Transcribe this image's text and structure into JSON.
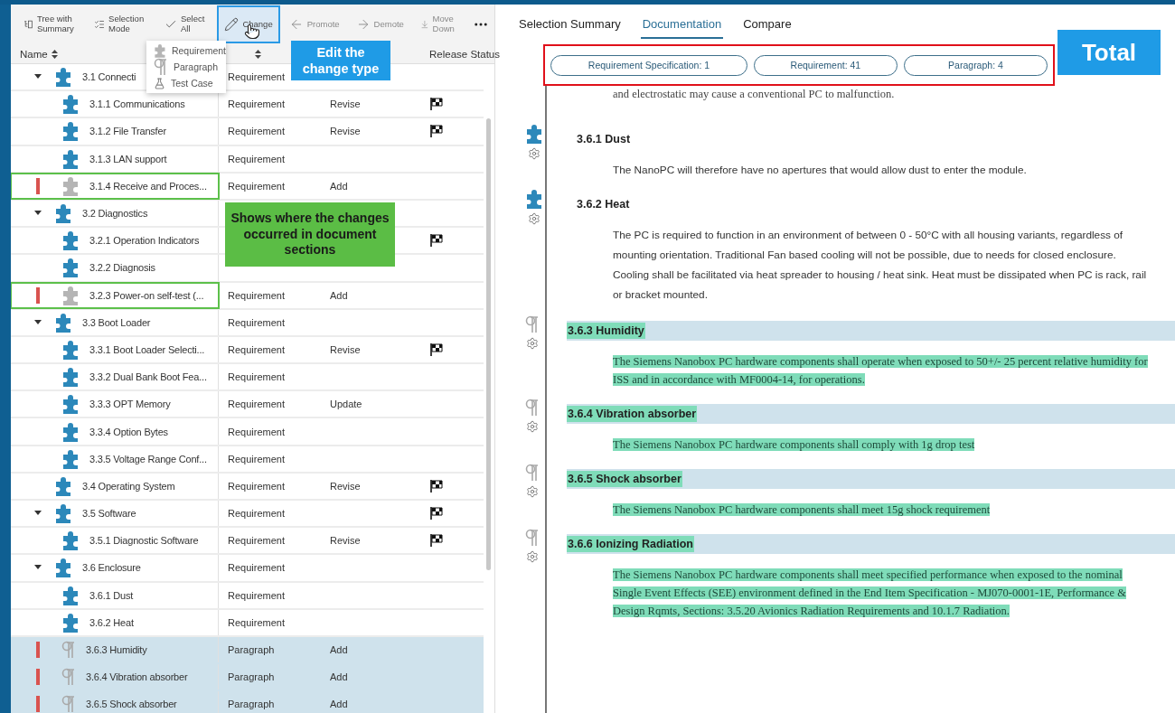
{
  "toolbar": {
    "items": [
      {
        "label": "Tree with Summary",
        "disabled": false,
        "outlined": false
      },
      {
        "label": "Selection Mode",
        "disabled": false,
        "outlined": false
      },
      {
        "label": "Select All",
        "disabled": false,
        "outlined": false
      },
      {
        "label": "Change",
        "disabled": false,
        "outlined": true
      },
      {
        "label": "Promote",
        "disabled": true,
        "outlined": false
      },
      {
        "label": "Demote",
        "disabled": true,
        "outlined": false
      },
      {
        "label": "Move Down",
        "disabled": true,
        "outlined": false
      }
    ]
  },
  "change_menu": {
    "items": [
      {
        "label": "Requirement"
      },
      {
        "label": "Paragraph"
      },
      {
        "label": "Test Case"
      }
    ]
  },
  "columns": {
    "name": "Name",
    "release_status": "Release Status"
  },
  "tree": [
    {
      "name": "3.1 Connecti",
      "type": "Requirement",
      "kind": "requirement",
      "expanded": true,
      "changed": false,
      "outlined": false,
      "selected": false,
      "flag": false,
      "children": [
        {
          "name": "3.1.1 Communications",
          "type": "Requirement",
          "change": "Revise",
          "kind": "requirement",
          "changed": false,
          "outlined": false,
          "selected": false,
          "flag": true
        },
        {
          "name": "3.1.2 File Transfer",
          "type": "Requirement",
          "change": "Revise",
          "kind": "requirement",
          "changed": false,
          "outlined": false,
          "selected": false,
          "flag": true
        },
        {
          "name": "3.1.3 LAN support",
          "type": "Requirement",
          "kind": "requirement",
          "changed": false,
          "outlined": false,
          "selected": false,
          "flag": false
        },
        {
          "name": "3.1.4 Receive and Proces...",
          "type": "Requirement",
          "change": "Add",
          "kind": "requirement",
          "changed": true,
          "outlined": true,
          "selected": false,
          "flag": false
        }
      ]
    },
    {
      "name": "3.2 Diagnostics",
      "kind": "requirement",
      "expanded": true,
      "changed": false,
      "outlined": false,
      "selected": false,
      "flag": false,
      "children": [
        {
          "name": "3.2.1 Operation Indicators",
          "kind": "requirement",
          "changed": false,
          "outlined": false,
          "selected": false,
          "flag": true
        },
        {
          "name": "3.2.2 Diagnosis",
          "kind": "requirement",
          "changed": false,
          "outlined": false,
          "selected": false,
          "flag": false
        },
        {
          "name": "3.2.3 Power-on self-test (...",
          "type": "Requirement",
          "change": "Add",
          "kind": "requirement",
          "changed": true,
          "outlined": true,
          "selected": false,
          "flag": false
        }
      ]
    },
    {
      "name": "3.3 Boot Loader",
      "type": "Requirement",
      "kind": "requirement",
      "expanded": true,
      "changed": false,
      "outlined": false,
      "selected": false,
      "flag": false,
      "children": [
        {
          "name": "3.3.1 Boot Loader Selecti...",
          "type": "Requirement",
          "change": "Revise",
          "kind": "requirement",
          "changed": false,
          "outlined": false,
          "selected": false,
          "flag": true
        },
        {
          "name": "3.3.2 Dual Bank Boot Fea...",
          "type": "Requirement",
          "kind": "requirement",
          "changed": false,
          "outlined": false,
          "selected": false,
          "flag": false
        },
        {
          "name": "3.3.3 OPT Memory",
          "type": "Requirement",
          "change": "Update",
          "kind": "requirement",
          "changed": false,
          "outlined": false,
          "selected": false,
          "flag": false
        },
        {
          "name": "3.3.4 Option Bytes",
          "type": "Requirement",
          "kind": "requirement",
          "changed": false,
          "outlined": false,
          "selected": false,
          "flag": false
        },
        {
          "name": "3.3.5 Voltage Range Conf...",
          "type": "Requirement",
          "kind": "requirement",
          "changed": false,
          "outlined": false,
          "selected": false,
          "flag": false
        }
      ]
    },
    {
      "name": "3.4 Operating System",
      "type": "Requirement",
      "change": "Revise",
      "kind": "requirement",
      "changed": false,
      "outlined": false,
      "selected": false,
      "flag": true
    },
    {
      "name": "3.5 Software",
      "type": "Requirement",
      "kind": "requirement",
      "expanded": true,
      "changed": false,
      "outlined": false,
      "selected": false,
      "flag": true,
      "children": [
        {
          "name": "3.5.1 Diagnostic Software",
          "type": "Requirement",
          "change": "Revise",
          "kind": "requirement",
          "changed": false,
          "outlined": false,
          "selected": false,
          "flag": true
        }
      ]
    },
    {
      "name": "3.6 Enclosure",
      "type": "Requirement",
      "kind": "requirement",
      "expanded": true,
      "changed": false,
      "outlined": false,
      "selected": false,
      "flag": false,
      "children": [
        {
          "name": "3.6.1 Dust",
          "type": "Requirement",
          "kind": "requirement",
          "changed": false,
          "outlined": false,
          "selected": false,
          "flag": false
        },
        {
          "name": "3.6.2 Heat",
          "type": "Requirement",
          "kind": "requirement",
          "changed": false,
          "outlined": false,
          "selected": false,
          "flag": false
        },
        {
          "name": "3.6.3 Humidity",
          "type": "Paragraph",
          "change": "Add",
          "kind": "paragraph",
          "changed": true,
          "outlined": false,
          "selected": true,
          "flag": false
        },
        {
          "name": "3.6.4 Vibration absorber",
          "type": "Paragraph",
          "change": "Add",
          "kind": "paragraph",
          "changed": true,
          "outlined": false,
          "selected": true,
          "flag": false
        },
        {
          "name": "3.6.5 Shock absorber",
          "type": "Paragraph",
          "change": "Add",
          "kind": "paragraph",
          "changed": true,
          "outlined": false,
          "selected": true,
          "flag": false
        }
      ]
    }
  ],
  "tabs": [
    {
      "label": "Selection Summary",
      "selected": false
    },
    {
      "label": "Documentation",
      "selected": true
    },
    {
      "label": "Compare",
      "selected": false
    }
  ],
  "totals": [
    {
      "label": "Requirement Specification: 1"
    },
    {
      "label": "Requirement: 41"
    },
    {
      "label": "Paragraph: 4"
    }
  ],
  "document": {
    "cut_text": "and electrostatic may cause a conventional PC to malfunction.",
    "sections": [
      {
        "heading": "3.6.1 Dust",
        "kind": "requirement",
        "added": false,
        "body": "The NanoPC will therefore have no apertures that would allow dust to enter the module."
      },
      {
        "heading": "3.6.2 Heat",
        "kind": "requirement",
        "added": false,
        "body": "The PC is required to function in an environment of between 0 - 50°C with all housing variants, regardless of mounting orientation. Traditional Fan based cooling will not be possible, due to needs for closed enclosure. Cooling shall be facilitated via heat spreader to housing / heat sink. Heat must be dissipated when PC is rack, rail or bracket mounted."
      },
      {
        "heading": "3.6.3 Humidity",
        "kind": "paragraph",
        "added": true,
        "body": "The Siemens Nanobox PC hardware components shall operate when exposed to 50+/- 25 percent relative humidity for ISS and in accordance with MF0004-14, for operations."
      },
      {
        "heading": "3.6.4 Vibration absorber",
        "kind": "paragraph",
        "added": true,
        "body": "The Siemens Nanobox PC hardware components shall comply with 1g drop test"
      },
      {
        "heading": "3.6.5 Shock absorber",
        "kind": "paragraph",
        "added": true,
        "body": "The Siemens Nanobox PC hardware components shall meet 15g shock requirement"
      },
      {
        "heading": "3.6.6 Ionizing Radiation",
        "kind": "paragraph",
        "added": true,
        "body": "The Siemens Nanobox PC hardware components shall meet specified performance when exposed to the nominal Single Event Effects (SEE) environment defined in the End Item Specification - MJ070-0001-1E, Performance & Design Rqmts, Sections: 3.5.20 Avionics Radiation Requirements and 10.1.7 Radiation."
      }
    ]
  },
  "annotations": {
    "edit_callout": "Edit the change type",
    "sections_callout": "Shows where the changes occurred in document sections",
    "total_callout": "Total"
  }
}
